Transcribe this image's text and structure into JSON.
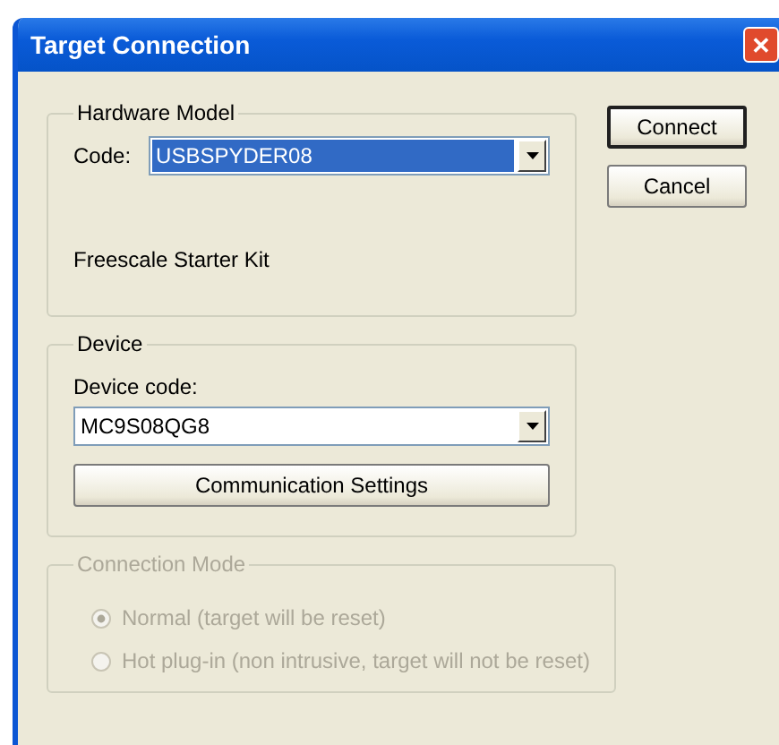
{
  "window": {
    "title": "Target Connection",
    "close_icon": "✕"
  },
  "hardware_model": {
    "title": "Hardware Model",
    "code_label": "Code:",
    "code_value": "USBSPYDER08",
    "code_highlighted": true,
    "description": "Freescale Starter Kit"
  },
  "device": {
    "title": "Device",
    "code_label": "Device code:",
    "code_value": "MC9S08QG8",
    "code_highlighted": false,
    "settings_button": "Communication Settings"
  },
  "connection_mode": {
    "title": "Connection Mode",
    "disabled": true,
    "options": [
      {
        "label": "Normal (target will be reset)",
        "selected": true
      },
      {
        "label": "Hot plug-in (non intrusive, target will not be reset)",
        "selected": false
      }
    ]
  },
  "buttons": [
    {
      "label": "Connect",
      "default": true
    },
    {
      "label": "Cancel",
      "default": false
    }
  ]
}
